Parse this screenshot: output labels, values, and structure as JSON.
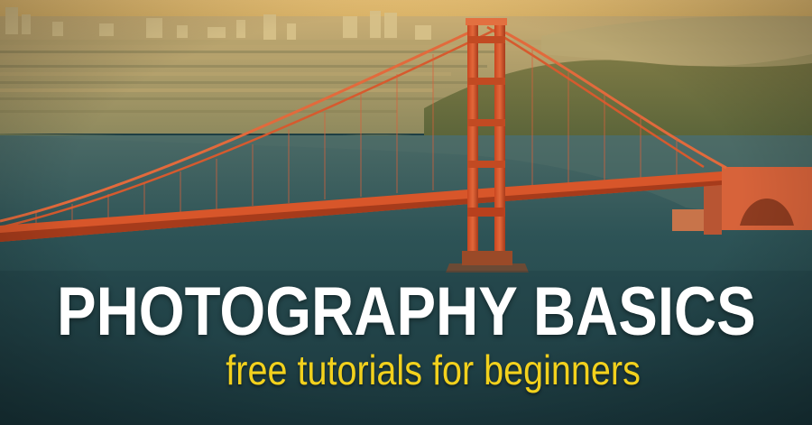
{
  "banner": {
    "title": "PHOTOGRAPHY BASICS",
    "subtitle": "free tutorials for beginners"
  },
  "colors": {
    "title": "#ffffff",
    "subtitle": "#f2d11d",
    "bridge": "#d9532a",
    "water": "#2c5154",
    "sky": "#e6bb6a"
  },
  "image": {
    "subject": "golden-gate-bridge-photo"
  }
}
